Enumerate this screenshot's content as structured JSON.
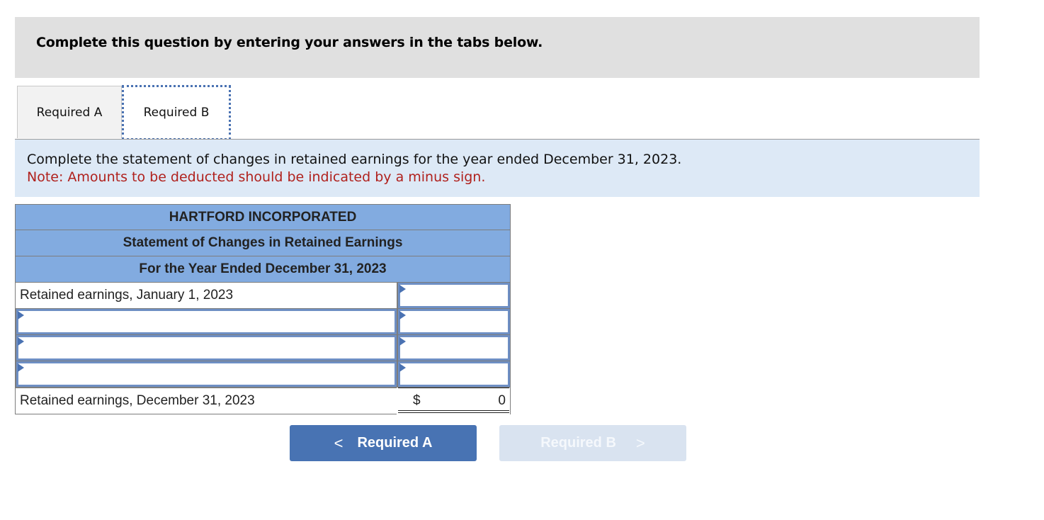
{
  "instruction": "Complete this question by entering your answers in the tabs below.",
  "tabs": [
    {
      "label": "Required A",
      "active": false
    },
    {
      "label": "Required B",
      "active": true
    }
  ],
  "prompt": {
    "text": "Complete the statement of changes in retained earnings for the year ended December 31, 2023.",
    "note": "Note: Amounts to be deducted should be indicated by a minus sign."
  },
  "statement": {
    "company": "HARTFORD INCORPORATED",
    "title": "Statement of Changes in Retained Earnings",
    "period": "For the Year Ended December 31, 2023",
    "rows": [
      {
        "label": "Retained earnings, January 1, 2023",
        "label_editable": false,
        "amount": ""
      },
      {
        "label": "",
        "label_editable": true,
        "amount": ""
      },
      {
        "label": "",
        "label_editable": true,
        "amount": ""
      },
      {
        "label": "",
        "label_editable": true,
        "amount": ""
      }
    ],
    "total": {
      "label": "Retained earnings, December 31, 2023",
      "currency": "$",
      "amount": "0"
    }
  },
  "navigation": {
    "prev": {
      "label": "Required A",
      "icon": "chevron-left-icon",
      "glyph": "<",
      "enabled": true
    },
    "next": {
      "label": "Required B",
      "icon": "chevron-right-icon",
      "glyph": ">",
      "enabled": false
    }
  },
  "colors": {
    "accent": "#4873b3",
    "header_fill": "#82abe0",
    "note_red": "#b0211d",
    "prompt_bg": "#dde9f6"
  }
}
